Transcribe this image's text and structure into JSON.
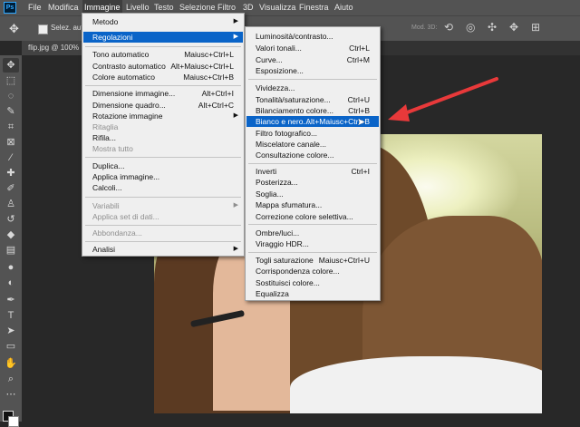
{
  "menubar": {
    "items": [
      "File",
      "Modifica",
      "Immagine",
      "Livello",
      "Testo",
      "Selezione",
      "Filtro",
      "3D",
      "Visualizza",
      "Finestra",
      "Aiuto"
    ]
  },
  "options": {
    "selez_label": "Selez. auto",
    "mode_3d_label": "Mod. 3D:"
  },
  "document": {
    "tab_title": "flip.jpg @ 100%"
  },
  "immagine_menu": {
    "items": [
      {
        "label": "Metodo"
      },
      {
        "label": "Regolazioni"
      },
      {
        "label": "Tono automatico",
        "shortcut": "Maiusc+Ctrl+L"
      },
      {
        "label": "Contrasto automatico",
        "shortcut": "Alt+Maiusc+Ctrl+L"
      },
      {
        "label": "Colore automatico",
        "shortcut": "Maiusc+Ctrl+B"
      },
      {
        "label": "Dimensione immagine...",
        "shortcut": "Alt+Ctrl+I"
      },
      {
        "label": "Dimensione quadro...",
        "shortcut": "Alt+Ctrl+C"
      },
      {
        "label": "Rotazione immagine"
      },
      {
        "label": "Ritaglia"
      },
      {
        "label": "Rifila..."
      },
      {
        "label": "Mostra tutto"
      },
      {
        "label": "Duplica..."
      },
      {
        "label": "Applica immagine..."
      },
      {
        "label": "Calcoli..."
      },
      {
        "label": "Variabili"
      },
      {
        "label": "Applica set di dati..."
      },
      {
        "label": "Abbondanza..."
      },
      {
        "label": "Analisi"
      }
    ]
  },
  "regolazioni_menu": {
    "items": [
      {
        "label": "Luminosità/contrasto..."
      },
      {
        "label": "Valori tonali...",
        "shortcut": "Ctrl+L"
      },
      {
        "label": "Curve...",
        "shortcut": "Ctrl+M"
      },
      {
        "label": "Esposizione..."
      },
      {
        "label": "Vividezza..."
      },
      {
        "label": "Tonalità/saturazione...",
        "shortcut": "Ctrl+U"
      },
      {
        "label": "Bilanciamento colore...",
        "shortcut": "Ctrl+B"
      },
      {
        "label": "Bianco e nero...",
        "shortcut": "Alt+Maiusc+Ctrl+B"
      },
      {
        "label": "Filtro fotografico..."
      },
      {
        "label": "Miscelatore canale..."
      },
      {
        "label": "Consultazione colore..."
      },
      {
        "label": "Inverti",
        "shortcut": "Ctrl+I"
      },
      {
        "label": "Posterizza..."
      },
      {
        "label": "Soglia..."
      },
      {
        "label": "Mappa sfumatura..."
      },
      {
        "label": "Correzione colore selettiva..."
      },
      {
        "label": "Ombre/luci..."
      },
      {
        "label": "Viraggio HDR..."
      },
      {
        "label": "Togli saturazione",
        "shortcut": "Maiusc+Ctrl+U"
      },
      {
        "label": "Corrispondenza colore..."
      },
      {
        "label": "Sostituisci colore..."
      },
      {
        "label": "Equalizza"
      }
    ]
  },
  "colors": {
    "highlight": "#0a64c8",
    "annotation_arrow": "#e8393a",
    "app_chrome": "#535353",
    "workspace": "#282828",
    "menu_bg": "#efefef"
  },
  "icons": {
    "app": "photoshop-logo-icon",
    "submenu": "chevron-right-icon",
    "tools": [
      "move-icon",
      "marquee-icon",
      "lasso-icon",
      "quick-select-icon",
      "crop-icon",
      "frame-icon",
      "eyedropper-icon",
      "healing-brush-icon",
      "brush-icon",
      "clone-stamp-icon",
      "history-brush-icon",
      "eraser-icon",
      "gradient-icon",
      "blur-icon",
      "dodge-icon",
      "pen-icon",
      "type-icon",
      "path-select-icon",
      "shape-icon",
      "hand-icon",
      "zoom-icon",
      "more-tools-icon"
    ]
  }
}
